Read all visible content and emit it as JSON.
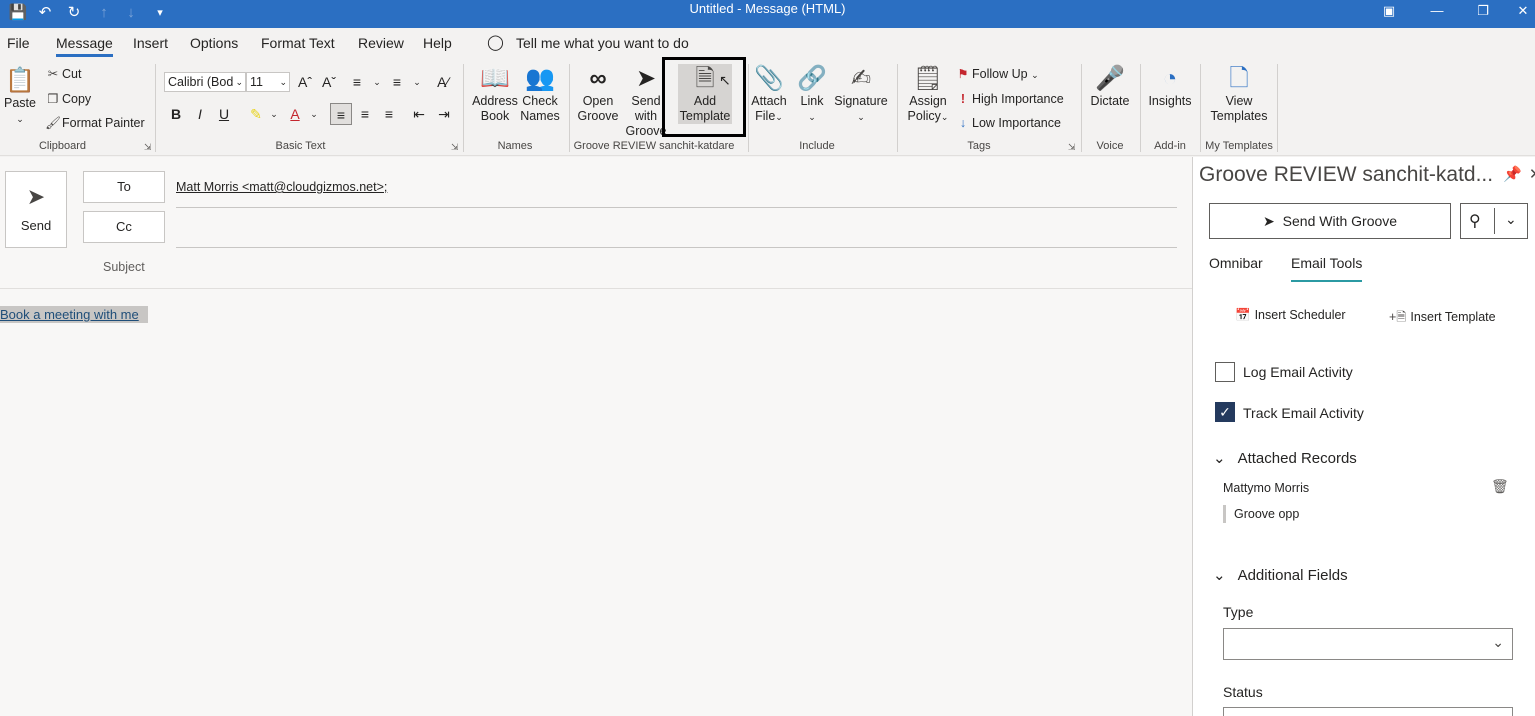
{
  "window": {
    "title": "Untitled  -  Message (HTML)"
  },
  "menu": {
    "tabs": [
      "File",
      "Message",
      "Insert",
      "Options",
      "Format Text",
      "Review",
      "Help"
    ],
    "search_placeholder": "Tell me what you want to do"
  },
  "ribbon": {
    "clipboard": {
      "paste": "Paste",
      "cut": "Cut",
      "copy": "Copy",
      "format_painter": "Format Painter",
      "label": "Clipboard"
    },
    "basic_text": {
      "font": "Calibri (Bod",
      "size": "11",
      "label": "Basic Text"
    },
    "names": {
      "address_book": [
        "Address",
        "Book"
      ],
      "check_names": [
        "Check",
        "Names"
      ],
      "label": "Names"
    },
    "groove": {
      "open_groove": [
        "Open",
        "Groove"
      ],
      "send_with_groove": [
        "Send with",
        "Groove"
      ],
      "add_template": [
        "Add",
        "Template"
      ],
      "label": "Groove REVIEW sanchit-katdare"
    },
    "include": {
      "attach_file": [
        "Attach",
        "File"
      ],
      "link": "Link",
      "signature": "Signature",
      "label": "Include"
    },
    "tags": {
      "assign_policy": [
        "Assign",
        "Policy"
      ],
      "follow_up": "Follow Up",
      "high_importance": "High Importance",
      "low_importance": "Low Importance",
      "label": "Tags"
    },
    "voice": {
      "dictate": "Dictate",
      "label": "Voice"
    },
    "addin": {
      "insights": "Insights",
      "label": "Add-in"
    },
    "my_templates": {
      "view_templates": [
        "View",
        "Templates"
      ],
      "label": "My Templates"
    }
  },
  "compose": {
    "send": "Send",
    "to_label": "To",
    "cc_label": "Cc",
    "subject_label": "Subject",
    "to_value": "Matt Morris <matt@cloudgizmos.net>;",
    "body_link": "Book a meeting with me"
  },
  "taskpane": {
    "title": "Groove REVIEW sanchit-katd...",
    "send_with_groove": "Send With Groove",
    "tabs": [
      "Omnibar",
      "Email Tools"
    ],
    "insert_scheduler": "Insert Scheduler",
    "insert_template": "Insert Template",
    "log_email_activity": "Log Email Activity",
    "track_email_activity": "Track Email Activity",
    "attached_records": "Attached Records",
    "record_name": "Mattymo Morris",
    "record_opp": "Groove opp",
    "additional_fields": "Additional Fields",
    "type_label": "Type",
    "status_label": "Status"
  },
  "colors": {
    "titlebar": "#2b6fc2",
    "checkbox_checked": "#243a5e",
    "accent": "#2b6fc2"
  }
}
